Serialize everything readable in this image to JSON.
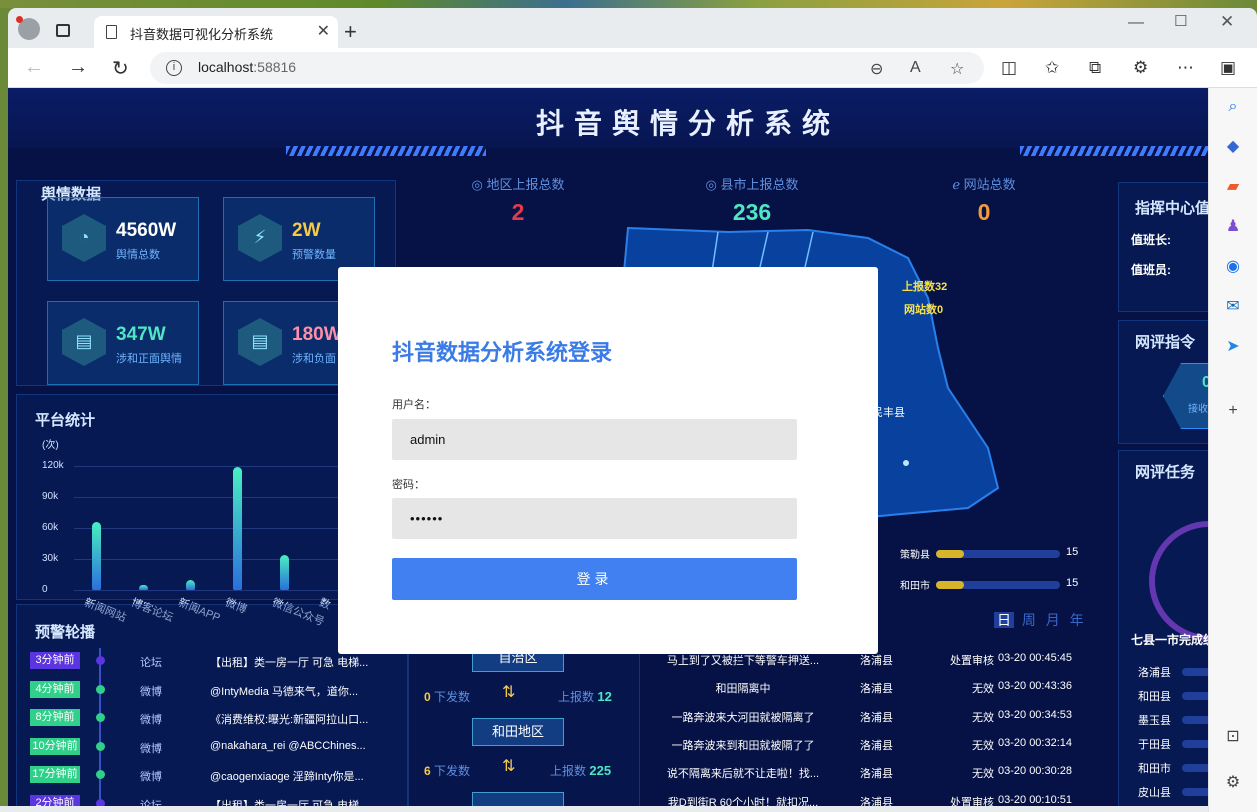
{
  "browser": {
    "tab_title": "抖音数据可视化分析系统",
    "url_host": "localhost",
    "url_port": ":58816"
  },
  "dashboard": {
    "title": "抖音舆情分析系统",
    "sentiment_panel_title": "舆情数据",
    "cards": [
      {
        "value": "4560W",
        "label": "舆情总数",
        "color": "#ffffff"
      },
      {
        "value": "2W",
        "label": "预警数量",
        "color": "#f7c948"
      },
      {
        "value": "347W",
        "label": "涉和正面舆情",
        "color": "#4fe6c4"
      },
      {
        "value": "180W",
        "label": "涉和负面",
        "color": "#ff8fa8"
      }
    ],
    "stats": [
      {
        "label": "地区上报总数",
        "value": "2",
        "color": "#e23c4c"
      },
      {
        "label": "县市上报总数",
        "value": "236",
        "color": "#4fe6c4"
      },
      {
        "label": "网站总数",
        "value": "0",
        "color": "#f39a3a"
      }
    ],
    "map_labels": {
      "reported": "上报数32",
      "sites": "网站数0",
      "county": "民丰县"
    },
    "map_bars": [
      {
        "label": "策勒县",
        "value": "15"
      },
      {
        "label": "和田市",
        "value": "15"
      }
    ],
    "platform_panel_title": "平台统计",
    "alert_panel_title": "预警轮播",
    "command_title": "指挥中心值",
    "duty_chief": "值班长:",
    "duty_staff": "值班员:",
    "review_title": "网评指令",
    "review_receive": "接收总",
    "review_count": "0",
    "task_title": "网评任务",
    "county_complete_title": "七县一市完成统",
    "counties": [
      "洛浦县",
      "和田县",
      "墨玉县",
      "于田县",
      "和田市",
      "皮山县"
    ],
    "date_tabs": [
      "日",
      "周",
      "月",
      "年"
    ],
    "regions": [
      {
        "name": "自治区",
        "down": "",
        "down_label": "",
        "up_label": "",
        "up": ""
      },
      {
        "name": "和田地区",
        "down": "0",
        "down_label": "下发数",
        "up_label": "上报数",
        "up": "12"
      },
      {
        "name": "",
        "down": "6",
        "down_label": "下发数",
        "up_label": "上报数",
        "up": "225"
      }
    ],
    "alerts": [
      {
        "time": "3分钟前",
        "src": "论坛",
        "msg": "【出租】类一房一厅 可急 电梯...",
        "color": "#5a35e0"
      },
      {
        "time": "4分钟前",
        "src": "微博",
        "msg": "@IntyMedia 马德来气，道你...",
        "color": "#2fd08a"
      },
      {
        "time": "8分钟前",
        "src": "微博",
        "msg": "《消费维权:曝光:新疆阿拉山口...",
        "color": "#2fd08a"
      },
      {
        "time": "10分钟前",
        "src": "微博",
        "msg": "@nakahara_rei @ABCChines...",
        "color": "#2fd08a"
      },
      {
        "time": "17分钟前",
        "src": "微博",
        "msg": "@caogenxiaoge 淫蹄Inty你是...",
        "color": "#2fd08a"
      },
      {
        "time": "2分钟前",
        "src": "论坛",
        "msg": "【出租】类一房一厅 可急 电梯...",
        "color": "#5a35e0"
      }
    ],
    "records": [
      {
        "title": "马上到了又被拦下等警车押送...",
        "county": "洛浦县",
        "status": "处置审核",
        "time": "03-20 00:45:45"
      },
      {
        "title": "和田隔离中",
        "county": "洛浦县",
        "status": "无效",
        "time": "03-20 00:43:36"
      },
      {
        "title": "一路奔波来大河田就被隔离了",
        "county": "洛浦县",
        "status": "无效",
        "time": "03-20 00:34:53"
      },
      {
        "title": "一路奔波来到和田就被隔了了",
        "county": "洛浦县",
        "status": "无效",
        "time": "03-20 00:32:14"
      },
      {
        "title": "说不隔离来后就不让走啦！找...",
        "county": "洛浦县",
        "status": "无效",
        "time": "03-20 00:30:28"
      },
      {
        "title": "我D到街R 60个小时！就扣况...",
        "county": "洛浦县",
        "status": "处置审核",
        "time": "03-20 00:10:51"
      }
    ]
  },
  "chart_data": {
    "type": "bar",
    "title": "",
    "ylabel": "(次)",
    "ylim": [
      0,
      120000
    ],
    "yticks": [
      "120k",
      "90k",
      "60k",
      "30k",
      "0"
    ],
    "categories": [
      "新闻网站",
      "博客论坛",
      "新闻APP",
      "微博",
      "微信公众号",
      "数"
    ],
    "values": [
      66000,
      5000,
      10000,
      119000,
      34000,
      0
    ]
  },
  "login": {
    "title": "抖音数据分析系统登录",
    "username_label": "用户名：",
    "username_value": "admin",
    "password_label": "密码：",
    "password_value": "••••••",
    "submit_label": "登录"
  }
}
